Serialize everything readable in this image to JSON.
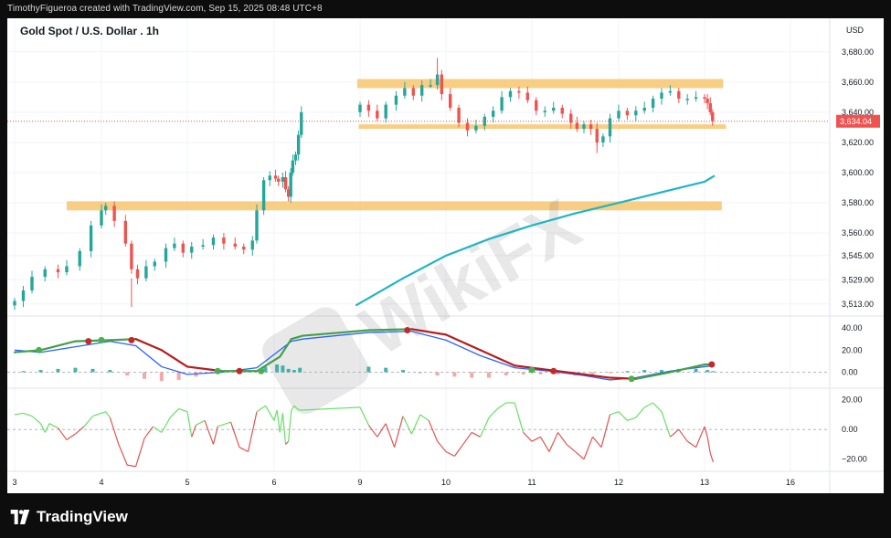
{
  "header": {
    "credit": "TimothyFigueroa created with TradingView.com, Sep 15, 2025 08:48 UTC+8"
  },
  "chart": {
    "title": "Gold Spot / U.S. Dollar . 1h",
    "currency": "USD"
  },
  "footer": {
    "brand": "TradingView"
  },
  "watermark": {
    "text": "WikiFX"
  },
  "colors": {
    "up": "#26a69a",
    "down": "#ef5350",
    "zone": "#f7c56f",
    "ma": "#1fb5c4",
    "macd": "#2962ff",
    "signal_up": "#43a047",
    "signal_down": "#b71c1c",
    "rsi_up": "#66e066",
    "rsi_down": "#e05353"
  },
  "chart_data": [
    {
      "type": "candlestick",
      "title": "Gold Spot / U.S. Dollar . 1h",
      "x_labels": [
        "3",
        "4",
        "5",
        "6",
        "9",
        "10",
        "11",
        "12",
        "13",
        "16"
      ],
      "y_ticks": [
        3513,
        3529,
        3545,
        3560,
        3580,
        3600,
        3620,
        3640,
        3660,
        3680
      ],
      "y_tick_labels": [
        "3,513.00",
        "3,529.00",
        "3,545.00",
        "3,560.00",
        "3,580.00",
        "3,600.00",
        "3,620.00",
        "3,640.00",
        "3,660.00",
        "3,680.00"
      ],
      "last_price": 3634.04,
      "last_price_label": "3,634.04",
      "ylim": [
        3505,
        3695
      ],
      "close_path": [
        [
          3.0,
          3515
        ],
        [
          3.1,
          3522
        ],
        [
          3.2,
          3531
        ],
        [
          3.35,
          3536
        ],
        [
          3.5,
          3534
        ],
        [
          3.6,
          3538
        ],
        [
          3.75,
          3548
        ],
        [
          3.88,
          3565
        ],
        [
          4.0,
          3575
        ],
        [
          4.05,
          3578
        ],
        [
          4.15,
          3568
        ],
        [
          4.28,
          3553
        ],
        [
          4.35,
          3536
        ],
        [
          4.42,
          3530
        ],
        [
          4.52,
          3538
        ],
        [
          4.62,
          3541
        ],
        [
          4.75,
          3550
        ],
        [
          4.85,
          3553
        ],
        [
          4.95,
          3547
        ],
        [
          5.05,
          3551
        ],
        [
          5.18,
          3552
        ],
        [
          5.3,
          3557
        ],
        [
          5.42,
          3553
        ],
        [
          5.55,
          3551
        ],
        [
          5.65,
          3549
        ],
        [
          5.75,
          3555
        ],
        [
          5.8,
          3575
        ],
        [
          5.88,
          3595
        ],
        [
          5.95,
          3598
        ],
        [
          6.05,
          3596
        ],
        [
          6.15,
          3594
        ],
        [
          6.3,
          3597
        ],
        [
          6.4,
          3589
        ],
        [
          6.5,
          3584
        ],
        [
          6.58,
          3600
        ],
        [
          6.65,
          3608
        ],
        [
          6.75,
          3612
        ],
        [
          6.85,
          3625
        ],
        [
          6.95,
          3640
        ],
        [
          9.0,
          3645
        ],
        [
          9.1,
          3641
        ],
        [
          9.2,
          3636
        ],
        [
          9.3,
          3645
        ],
        [
          9.42,
          3651
        ],
        [
          9.52,
          3656
        ],
        [
          9.62,
          3651
        ],
        [
          9.72,
          3658
        ],
        [
          9.82,
          3658
        ],
        [
          9.9,
          3665
        ],
        [
          9.95,
          3652
        ],
        [
          10.05,
          3643
        ],
        [
          10.15,
          3633
        ],
        [
          10.25,
          3628
        ],
        [
          10.35,
          3631
        ],
        [
          10.45,
          3637
        ],
        [
          10.55,
          3641
        ],
        [
          10.65,
          3650
        ],
        [
          10.75,
          3654
        ],
        [
          10.85,
          3653
        ],
        [
          10.95,
          3648
        ],
        [
          11.05,
          3641
        ],
        [
          11.15,
          3641
        ],
        [
          11.25,
          3643
        ],
        [
          11.35,
          3639
        ],
        [
          11.45,
          3633
        ],
        [
          11.52,
          3629
        ],
        [
          11.6,
          3632
        ],
        [
          11.68,
          3629
        ],
        [
          11.75,
          3620
        ],
        [
          11.82,
          3624
        ],
        [
          11.9,
          3636
        ],
        [
          12.0,
          3641
        ],
        [
          12.1,
          3638
        ],
        [
          12.2,
          3641
        ],
        [
          12.3,
          3643
        ],
        [
          12.4,
          3649
        ],
        [
          12.5,
          3653
        ],
        [
          12.6,
          3654
        ],
        [
          12.7,
          3649
        ],
        [
          12.8,
          3649
        ],
        [
          12.9,
          3650
        ],
        [
          13.0,
          3649
        ],
        [
          13.1,
          3646
        ],
        [
          13.2,
          3640
        ],
        [
          13.28,
          3634.04
        ]
      ],
      "resistance_zones": [
        {
          "from": 8.9,
          "to": 13.65,
          "low": 3656,
          "high": 3662
        },
        {
          "from": 8.95,
          "to": 13.75,
          "low": 3629,
          "high": 3632
        },
        {
          "from": 3.6,
          "to": 13.6,
          "low": 3575,
          "high": 3581
        }
      ],
      "moving_average": [
        [
          8.85,
          3512
        ],
        [
          9.5,
          3530
        ],
        [
          10.0,
          3545
        ],
        [
          10.5,
          3556
        ],
        [
          11.0,
          3565
        ],
        [
          11.5,
          3573
        ],
        [
          12.0,
          3580
        ],
        [
          12.5,
          3587
        ],
        [
          13.0,
          3594
        ],
        [
          13.35,
          3598
        ]
      ]
    },
    {
      "type": "line",
      "title": "",
      "y_ticks": [
        40,
        20,
        0
      ],
      "y_tick_labels": [
        "40.00",
        "20.00",
        "0.00"
      ],
      "ylim": [
        -12,
        50
      ],
      "series": [
        {
          "values": [
            [
              3.0,
              20
            ],
            [
              3.3,
              18
            ],
            [
              3.7,
              23
            ],
            [
              4.1,
              28
            ],
            [
              4.4,
              24
            ],
            [
              4.7,
              5
            ],
            [
              5.0,
              -2
            ],
            [
              5.4,
              0
            ],
            [
              5.8,
              4
            ],
            [
              6.2,
              20
            ],
            [
              6.6,
              28
            ],
            [
              7.0,
              30
            ],
            [
              9.1,
              36
            ],
            [
              9.6,
              37
            ],
            [
              10.0,
              29
            ],
            [
              10.4,
              15
            ],
            [
              10.8,
              4
            ],
            [
              11.2,
              1
            ],
            [
              11.6,
              -3
            ],
            [
              11.9,
              -7
            ],
            [
              12.2,
              -5
            ],
            [
              12.6,
              1
            ],
            [
              13.0,
              5
            ],
            [
              13.3,
              6
            ]
          ]
        },
        {
          "values": [
            [
              3.0,
              18
            ],
            [
              3.3,
              20
            ],
            [
              3.7,
              28
            ],
            [
              4.1,
              29
            ],
            [
              4.4,
              30
            ],
            [
              4.7,
              20
            ],
            [
              5.0,
              5
            ],
            [
              5.4,
              1
            ],
            [
              5.8,
              1
            ],
            [
              6.2,
              14
            ],
            [
              6.6,
              30
            ],
            [
              7.0,
              33
            ],
            [
              9.1,
              38
            ],
            [
              9.6,
              39
            ],
            [
              10.0,
              34
            ],
            [
              10.4,
              20
            ],
            [
              10.8,
              6
            ],
            [
              11.2,
              2
            ],
            [
              11.6,
              -2
            ],
            [
              11.9,
              -5
            ],
            [
              12.2,
              -6
            ],
            [
              12.6,
              0
            ],
            [
              13.0,
              7
            ],
            [
              13.3,
              7
            ]
          ]
        }
      ],
      "histogram": [
        [
          3.1,
          1
        ],
        [
          3.3,
          2
        ],
        [
          3.5,
          3
        ],
        [
          3.7,
          4
        ],
        [
          3.9,
          3
        ],
        [
          4.1,
          2
        ],
        [
          4.3,
          -3
        ],
        [
          4.5,
          -6
        ],
        [
          4.7,
          -8
        ],
        [
          4.9,
          -7
        ],
        [
          5.1,
          -4
        ],
        [
          5.3,
          -1
        ],
        [
          5.5,
          1
        ],
        [
          5.7,
          2
        ],
        [
          5.9,
          5
        ],
        [
          6.1,
          7
        ],
        [
          6.3,
          6
        ],
        [
          6.5,
          3
        ],
        [
          6.7,
          2
        ],
        [
          6.9,
          4
        ],
        [
          9.1,
          5
        ],
        [
          9.3,
          4
        ],
        [
          9.5,
          2
        ],
        [
          9.7,
          -1
        ],
        [
          9.9,
          -3
        ],
        [
          10.1,
          -4
        ],
        [
          10.3,
          -5
        ],
        [
          10.5,
          -5
        ],
        [
          10.7,
          -3
        ],
        [
          10.9,
          -2
        ],
        [
          11.1,
          -2
        ],
        [
          11.3,
          -2
        ],
        [
          11.5,
          -3
        ],
        [
          11.7,
          -2
        ],
        [
          11.9,
          -1
        ],
        [
          12.1,
          1
        ],
        [
          12.3,
          2
        ],
        [
          12.5,
          2
        ],
        [
          12.7,
          3
        ],
        [
          12.9,
          3
        ],
        [
          13.1,
          2
        ],
        [
          13.3,
          1
        ]
      ],
      "cross_markers": [
        {
          "x": 3.28,
          "y": 20,
          "direction": "up"
        },
        {
          "x": 3.85,
          "y": 28,
          "direction": "down"
        },
        {
          "x": 4.0,
          "y": 29,
          "direction": "up"
        },
        {
          "x": 4.35,
          "y": 29,
          "direction": "down"
        },
        {
          "x": 5.35,
          "y": 1,
          "direction": "up"
        },
        {
          "x": 5.6,
          "y": 1,
          "direction": "down"
        },
        {
          "x": 5.85,
          "y": 1,
          "direction": "up"
        },
        {
          "x": 9.55,
          "y": 38,
          "direction": "down"
        },
        {
          "x": 11.0,
          "y": 2,
          "direction": "up"
        },
        {
          "x": 11.25,
          "y": 1,
          "direction": "down"
        },
        {
          "x": 12.15,
          "y": -6,
          "direction": "up"
        },
        {
          "x": 13.25,
          "y": 7,
          "direction": "down"
        }
      ]
    },
    {
      "type": "line",
      "title": "",
      "y_ticks": [
        20,
        0,
        -20
      ],
      "y_tick_labels": [
        "20.00",
        "0.00",
        "−20.00"
      ],
      "ylim": [
        -27,
        26
      ],
      "series": [
        {
          "values": [
            [
              3.0,
              10
            ],
            [
              3.1,
              11
            ],
            [
              3.2,
              9
            ],
            [
              3.3,
              4
            ],
            [
              3.35,
              -2
            ],
            [
              3.4,
              4
            ],
            [
              3.5,
              1
            ],
            [
              3.6,
              -7
            ],
            [
              3.7,
              -3
            ],
            [
              3.8,
              2
            ],
            [
              3.9,
              9
            ],
            [
              4.05,
              12
            ],
            [
              4.1,
              8
            ],
            [
              4.2,
              -10
            ],
            [
              4.3,
              -24
            ],
            [
              4.4,
              -25
            ],
            [
              4.5,
              -6
            ],
            [
              4.6,
              2
            ],
            [
              4.7,
              -2
            ],
            [
              4.8,
              8
            ],
            [
              4.9,
              14
            ],
            [
              5.0,
              12
            ],
            [
              5.05,
              -5
            ],
            [
              5.1,
              3
            ],
            [
              5.2,
              6
            ],
            [
              5.3,
              -10
            ],
            [
              5.35,
              2
            ],
            [
              5.5,
              5
            ],
            [
              5.6,
              -12
            ],
            [
              5.7,
              -15
            ],
            [
              5.8,
              12
            ],
            [
              5.9,
              16
            ],
            [
              6.0,
              6
            ],
            [
              6.1,
              13
            ],
            [
              6.2,
              -2
            ],
            [
              6.3,
              11
            ],
            [
              6.4,
              -10
            ],
            [
              6.5,
              -8
            ],
            [
              6.6,
              13
            ],
            [
              6.7,
              16
            ],
            [
              6.8,
              14
            ],
            [
              6.9,
              13
            ],
            [
              9.0,
              15
            ],
            [
              9.1,
              3
            ],
            [
              9.2,
              -5
            ],
            [
              9.3,
              4
            ],
            [
              9.4,
              -12
            ],
            [
              9.5,
              9
            ],
            [
              9.6,
              -3
            ],
            [
              9.7,
              10
            ],
            [
              9.8,
              6
            ],
            [
              9.9,
              -8
            ],
            [
              10.0,
              -15
            ],
            [
              10.1,
              -18
            ],
            [
              10.2,
              -10
            ],
            [
              10.3,
              -2
            ],
            [
              10.4,
              -5
            ],
            [
              10.5,
              8
            ],
            [
              10.6,
              14
            ],
            [
              10.7,
              18
            ],
            [
              10.8,
              18
            ],
            [
              10.9,
              -2
            ],
            [
              11.0,
              -8
            ],
            [
              11.1,
              -5
            ],
            [
              11.2,
              -15
            ],
            [
              11.3,
              -2
            ],
            [
              11.4,
              -10
            ],
            [
              11.5,
              -15
            ],
            [
              11.6,
              -20
            ],
            [
              11.7,
              -5
            ],
            [
              11.8,
              -12
            ],
            [
              11.9,
              10
            ],
            [
              12.0,
              12
            ],
            [
              12.1,
              6
            ],
            [
              12.2,
              8
            ],
            [
              12.3,
              15
            ],
            [
              12.4,
              18
            ],
            [
              12.5,
              12
            ],
            [
              12.6,
              -5
            ],
            [
              12.7,
              0
            ],
            [
              12.8,
              -8
            ],
            [
              12.9,
              -12
            ],
            [
              13.0,
              2
            ],
            [
              13.1,
              -5
            ],
            [
              13.2,
              -16
            ],
            [
              13.3,
              -22
            ]
          ]
        }
      ]
    }
  ]
}
